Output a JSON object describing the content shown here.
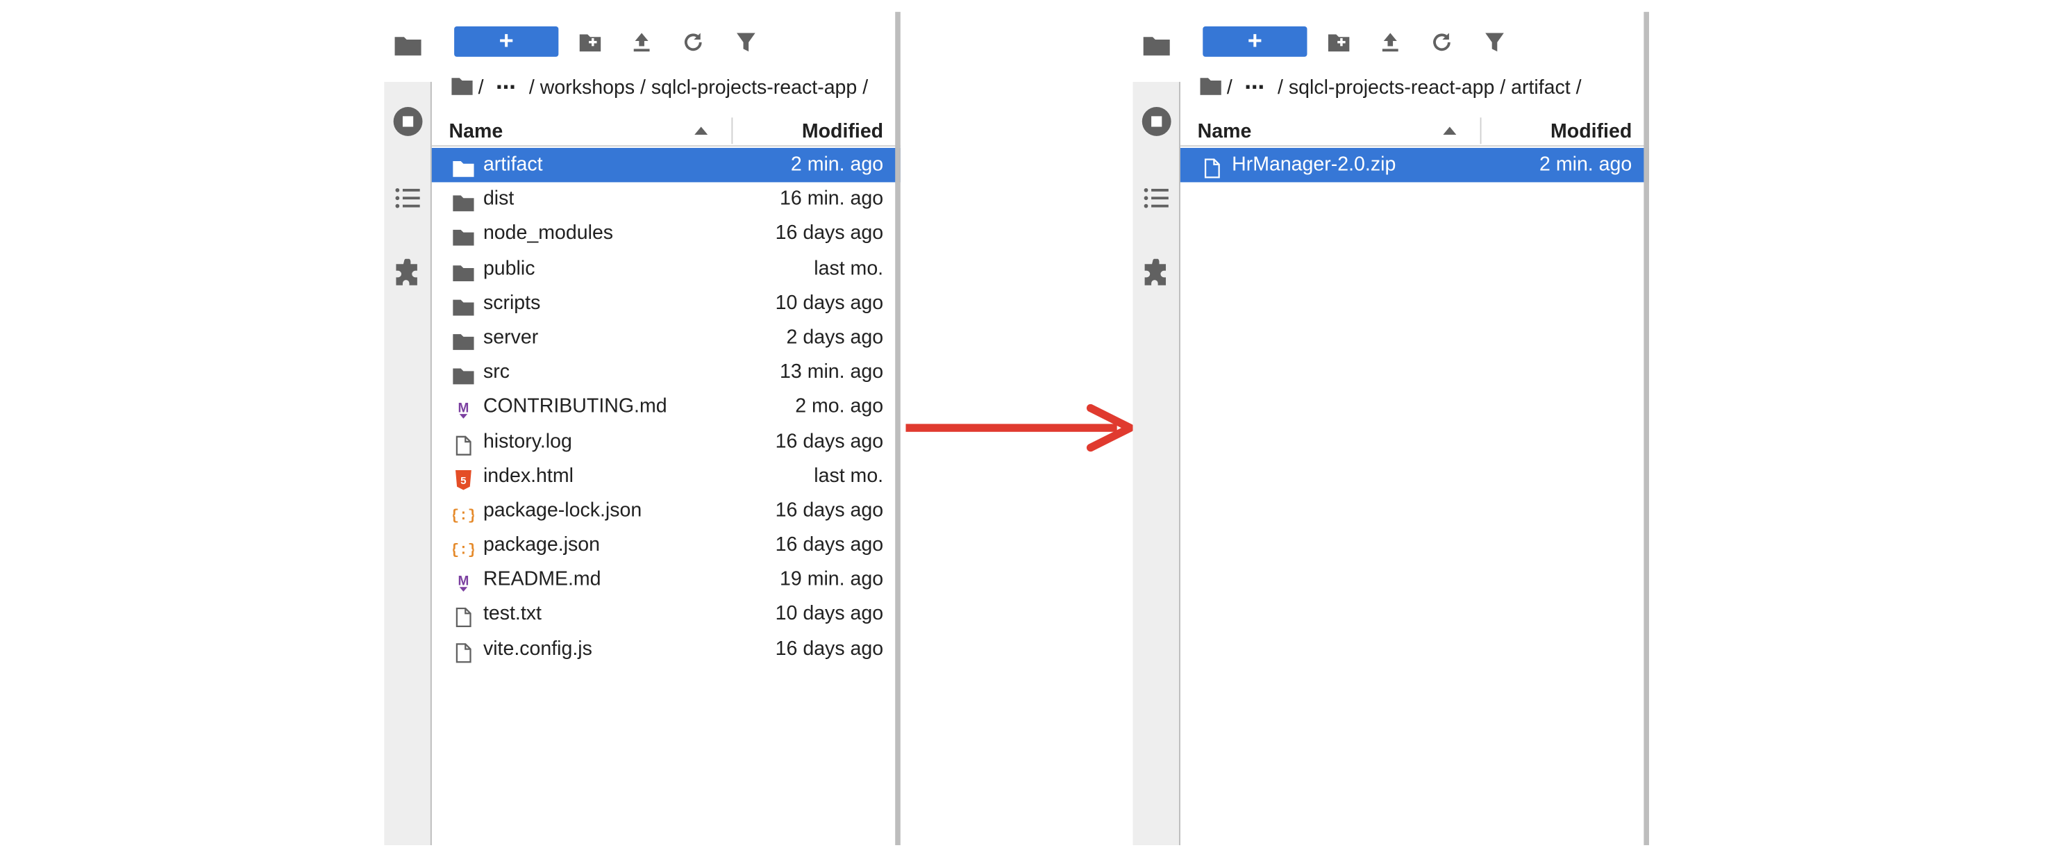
{
  "colors": {
    "accent": "#3677d6",
    "arrow": "#e03a2f",
    "icon_gray": "#616161",
    "markdown_purple": "#7b3fa0",
    "json_orange": "#e58a2b",
    "html_red": "#e44d26"
  },
  "left": {
    "toolbar": {
      "new_label": "+"
    },
    "breadcrumbs": {
      "sep1": "/",
      "ellipsis": "⋯",
      "path": "/ workshops / sqlcl-projects-react-app /"
    },
    "header": {
      "name": "Name",
      "modified": "Modified"
    },
    "files": [
      {
        "name": "artifact",
        "modified": "2 min. ago",
        "icon": "folder-icon"
      },
      {
        "name": "dist",
        "modified": "16 min. ago",
        "icon": "folder-icon"
      },
      {
        "name": "node_modules",
        "modified": "16 days ago",
        "icon": "folder-icon"
      },
      {
        "name": "public",
        "modified": "last mo.",
        "icon": "folder-icon"
      },
      {
        "name": "scripts",
        "modified": "10 days ago",
        "icon": "folder-icon"
      },
      {
        "name": "server",
        "modified": "2 days ago",
        "icon": "folder-icon"
      },
      {
        "name": "src",
        "modified": "13 min. ago",
        "icon": "folder-icon"
      },
      {
        "name": "CONTRIBUTING.md",
        "modified": "2 mo. ago",
        "icon": "markdown-icon"
      },
      {
        "name": "history.log",
        "modified": "16 days ago",
        "icon": "file-icon"
      },
      {
        "name": "index.html",
        "modified": "last mo.",
        "icon": "html-icon"
      },
      {
        "name": "package-lock.json",
        "modified": "16 days ago",
        "icon": "json-icon"
      },
      {
        "name": "package.json",
        "modified": "16 days ago",
        "icon": "json-icon"
      },
      {
        "name": "README.md",
        "modified": "19 min. ago",
        "icon": "markdown-icon"
      },
      {
        "name": "test.txt",
        "modified": "10 days ago",
        "icon": "file-icon"
      },
      {
        "name": "vite.config.js",
        "modified": "16 days ago",
        "icon": "file-icon"
      }
    ]
  },
  "right": {
    "toolbar": {
      "new_label": "+"
    },
    "breadcrumbs": {
      "sep1": "/",
      "ellipsis": "⋯",
      "path": "/ sqlcl-projects-react-app / artifact /"
    },
    "header": {
      "name": "Name",
      "modified": "Modified"
    },
    "files": [
      {
        "name": "HrManager-2.0.zip",
        "modified": "2 min. ago",
        "icon": "file-icon"
      }
    ]
  }
}
